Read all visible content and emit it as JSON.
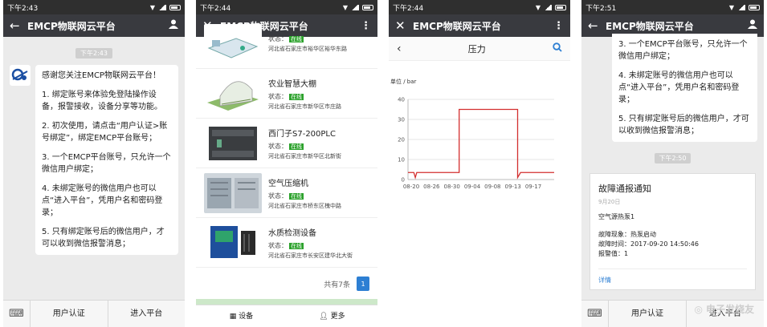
{
  "phone1": {
    "status_time": "下午2:43",
    "title": "EMCP物联网云平台",
    "timestamp": "下午2:43",
    "message": [
      "感谢您关注EMCP物联网云平台！",
      "1. 绑定账号来体验免登陆操作设备，报警接收，设备分享等功能。",
      "2. 初次使用，请点击“用户认证>账号绑定”，绑定EMCP平台账号；",
      "3. 一个EMCP平台账号，只允许一个微信用户绑定；",
      "4. 未绑定账号的微信用户也可以点“进入平台”，凭用户名和密码登录；",
      "5. 只有绑定账号后的微信用户，才可以收到微信报警消息；"
    ],
    "btn_auth": "用户认证",
    "btn_enter": "进入平台"
  },
  "phone2": {
    "status_time": "下午2:44",
    "title": "EMCP物联网云平台",
    "status_label": "状态：",
    "online": "在线",
    "devices": [
      {
        "name": "",
        "addr": "河北省石家庄市裕华区裕华东路"
      },
      {
        "name": "农业智慧大棚",
        "addr": "河北省石家庄市新华区市庄路"
      },
      {
        "name": "西门子S7-200PLC",
        "addr": "河北省石家庄市新华区北新街"
      },
      {
        "name": "空气压缩机",
        "addr": "河北省石家庄市桥东区槐中路"
      },
      {
        "name": "水质检测设备",
        "addr": "河北省石家庄市长安区建华北大街"
      }
    ],
    "total": "共有7条",
    "page": "1",
    "tab_device": "设备",
    "tab_more": "更多"
  },
  "phone3": {
    "status_time": "下午2:44",
    "title": "EMCP物联网云平台",
    "subtitle": "压力",
    "chart_data": {
      "type": "line",
      "ylabel": "单位 / bar",
      "ylim": [
        0,
        40
      ],
      "yticks": [
        "40",
        "30",
        "20",
        "10",
        "0"
      ],
      "xticks": [
        "08-20",
        "08-26",
        "08-30",
        "09-04",
        "09-08",
        "09-13",
        "09-17"
      ],
      "series": [
        {
          "points": [
            [
              0,
              3.5
            ],
            [
              0.04,
              3.5
            ],
            [
              0.05,
              1
            ],
            [
              0.06,
              3.5
            ],
            [
              0.35,
              3.5
            ],
            [
              0.35,
              35
            ],
            [
              0.75,
              35
            ],
            [
              0.75,
              1
            ],
            [
              0.77,
              3.5
            ],
            [
              1,
              3.5
            ]
          ]
        }
      ],
      "color": "#d32f2f"
    }
  },
  "phone4": {
    "status_time": "下午2:51",
    "title": "EMCP物联网云平台",
    "message": [
      "3. 一个EMCP平台账号，只允许一个微信用户绑定；",
      "4. 未绑定账号的微信用户也可以点“进入平台”，凭用户名和密码登录；",
      "5. 只有绑定账号后的微信用户，才可以收到微信报警消息；"
    ],
    "timestamp": "下午2:50",
    "card": {
      "title": "故障通报通知",
      "date": "9月20日",
      "device": "空气源热泵1",
      "line1": "故障现象：热泵启动",
      "line2": "故障时间：2017-09-20 14:50:46",
      "line3": "报警值：1",
      "more": "详情"
    },
    "btn_auth": "用户认证",
    "btn_enter": "进入平台",
    "watermark": "电子发烧友"
  }
}
